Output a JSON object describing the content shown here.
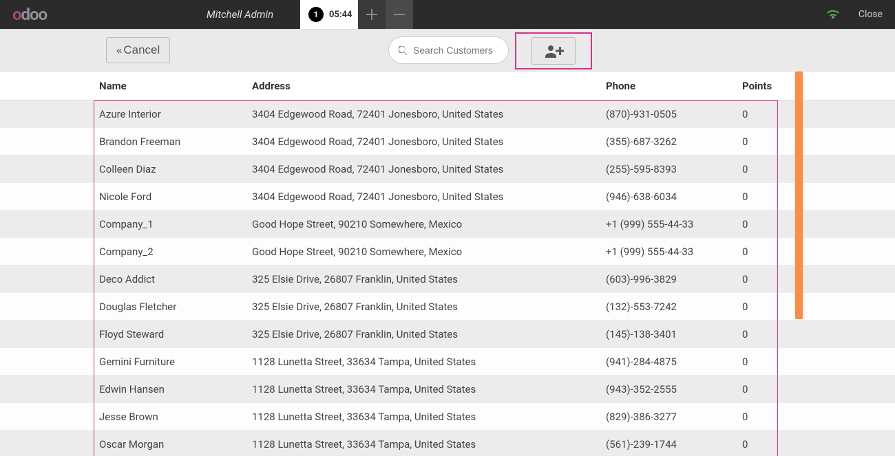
{
  "topbar": {
    "user": "Mitchell Admin",
    "order_number": "1",
    "order_time": "05:44",
    "close_label": "Close"
  },
  "toolbar": {
    "cancel_label": "Cancel",
    "search_placeholder": "Search Customers"
  },
  "table": {
    "headers": {
      "name": "Name",
      "address": "Address",
      "phone": "Phone",
      "points": "Points"
    },
    "rows": [
      {
        "name": "Azure Interior",
        "address": "3404 Edgewood Road, 72401 Jonesboro, United States",
        "phone": "(870)-931-0505",
        "points": "0"
      },
      {
        "name": "Brandon Freeman",
        "address": "3404 Edgewood Road, 72401 Jonesboro, United States",
        "phone": "(355)-687-3262",
        "points": "0"
      },
      {
        "name": "Colleen Diaz",
        "address": "3404 Edgewood Road, 72401 Jonesboro, United States",
        "phone": "(255)-595-8393",
        "points": "0"
      },
      {
        "name": "Nicole Ford",
        "address": "3404 Edgewood Road, 72401 Jonesboro, United States",
        "phone": "(946)-638-6034",
        "points": "0"
      },
      {
        "name": "Company_1",
        "address": "Good Hope Street, 90210 Somewhere, Mexico",
        "phone": "+1 (999) 555-44-33",
        "points": "0"
      },
      {
        "name": "Company_2",
        "address": "Good Hope Street, 90210 Somewhere, Mexico",
        "phone": "+1 (999) 555-44-33",
        "points": "0"
      },
      {
        "name": "Deco Addict",
        "address": "325 Elsie Drive, 26807 Franklin, United States",
        "phone": "(603)-996-3829",
        "points": "0"
      },
      {
        "name": "Douglas Fletcher",
        "address": "325 Elsie Drive, 26807 Franklin, United States",
        "phone": "(132)-553-7242",
        "points": "0"
      },
      {
        "name": "Floyd Steward",
        "address": "325 Elsie Drive, 26807 Franklin, United States",
        "phone": "(145)-138-3401",
        "points": "0"
      },
      {
        "name": "Gemini Furniture",
        "address": "1128 Lunetta Street, 33634 Tampa, United States",
        "phone": "(941)-284-4875",
        "points": "0"
      },
      {
        "name": "Edwin Hansen",
        "address": "1128 Lunetta Street, 33634 Tampa, United States",
        "phone": "(943)-352-2555",
        "points": "0"
      },
      {
        "name": "Jesse Brown",
        "address": "1128 Lunetta Street, 33634 Tampa, United States",
        "phone": "(829)-386-3277",
        "points": "0"
      },
      {
        "name": "Oscar Morgan",
        "address": "1128 Lunetta Street, 33634 Tampa, United States",
        "phone": "(561)-239-1744",
        "points": "0"
      }
    ]
  }
}
